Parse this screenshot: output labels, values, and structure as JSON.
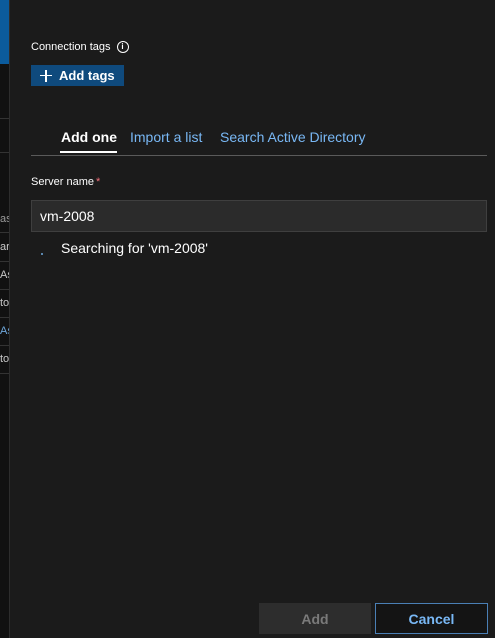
{
  "background_fragments": [
    "as",
    "ar",
    "As",
    "to",
    "As",
    "to"
  ],
  "connection_tags": {
    "label": "Connection tags",
    "info_icon": "i",
    "add_tags_button": "Add tags"
  },
  "tabs": [
    {
      "label": "Add one",
      "active": true
    },
    {
      "label": "Import a list",
      "active": false
    },
    {
      "label": "Search Active Directory",
      "active": false
    }
  ],
  "server_name": {
    "label": "Server name",
    "required_marker": "*",
    "value": "vm-2008",
    "status": "Searching for 'vm-2008'"
  },
  "footer": {
    "add_label": "Add",
    "cancel_label": "Cancel"
  },
  "colors": {
    "accent": "#0f4a7d",
    "link": "#79b8f5",
    "required": "#f1707b",
    "background": "#1b1b1b"
  }
}
